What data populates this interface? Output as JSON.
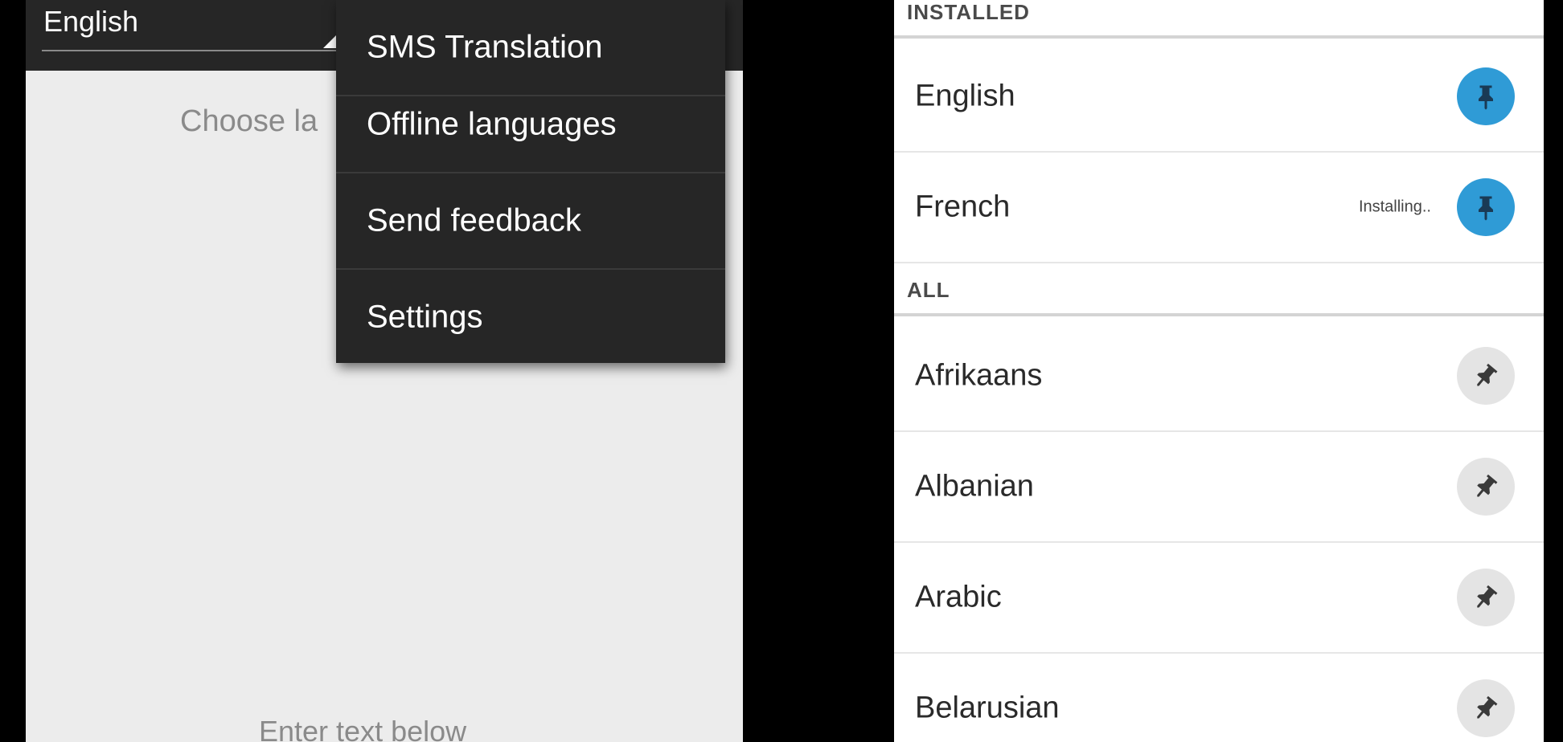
{
  "left_screen": {
    "spinner_value": "English",
    "choose_text": "Choose la",
    "enter_text": "Enter text below"
  },
  "overflow_menu": {
    "items": [
      {
        "label": "SMS Translation"
      },
      {
        "label": "Offline languages"
      },
      {
        "label": "Send feedback"
      },
      {
        "label": "Settings"
      }
    ]
  },
  "right_screen": {
    "installed_header": "INSTALLED",
    "all_header": "ALL",
    "installed": [
      {
        "name": "English",
        "status": ""
      },
      {
        "name": "French",
        "status": "Installing.."
      }
    ],
    "all": [
      {
        "name": "Afrikaans"
      },
      {
        "name": "Albanian"
      },
      {
        "name": "Arabic"
      },
      {
        "name": "Belarusian"
      }
    ]
  },
  "colors": {
    "action_bar": "#262626",
    "installed_pin": "#2f9bd6",
    "available_pin": "#e4e4e4"
  },
  "icons": {
    "installed_pin": "pin-icon",
    "available_pin": "pin-icon"
  }
}
